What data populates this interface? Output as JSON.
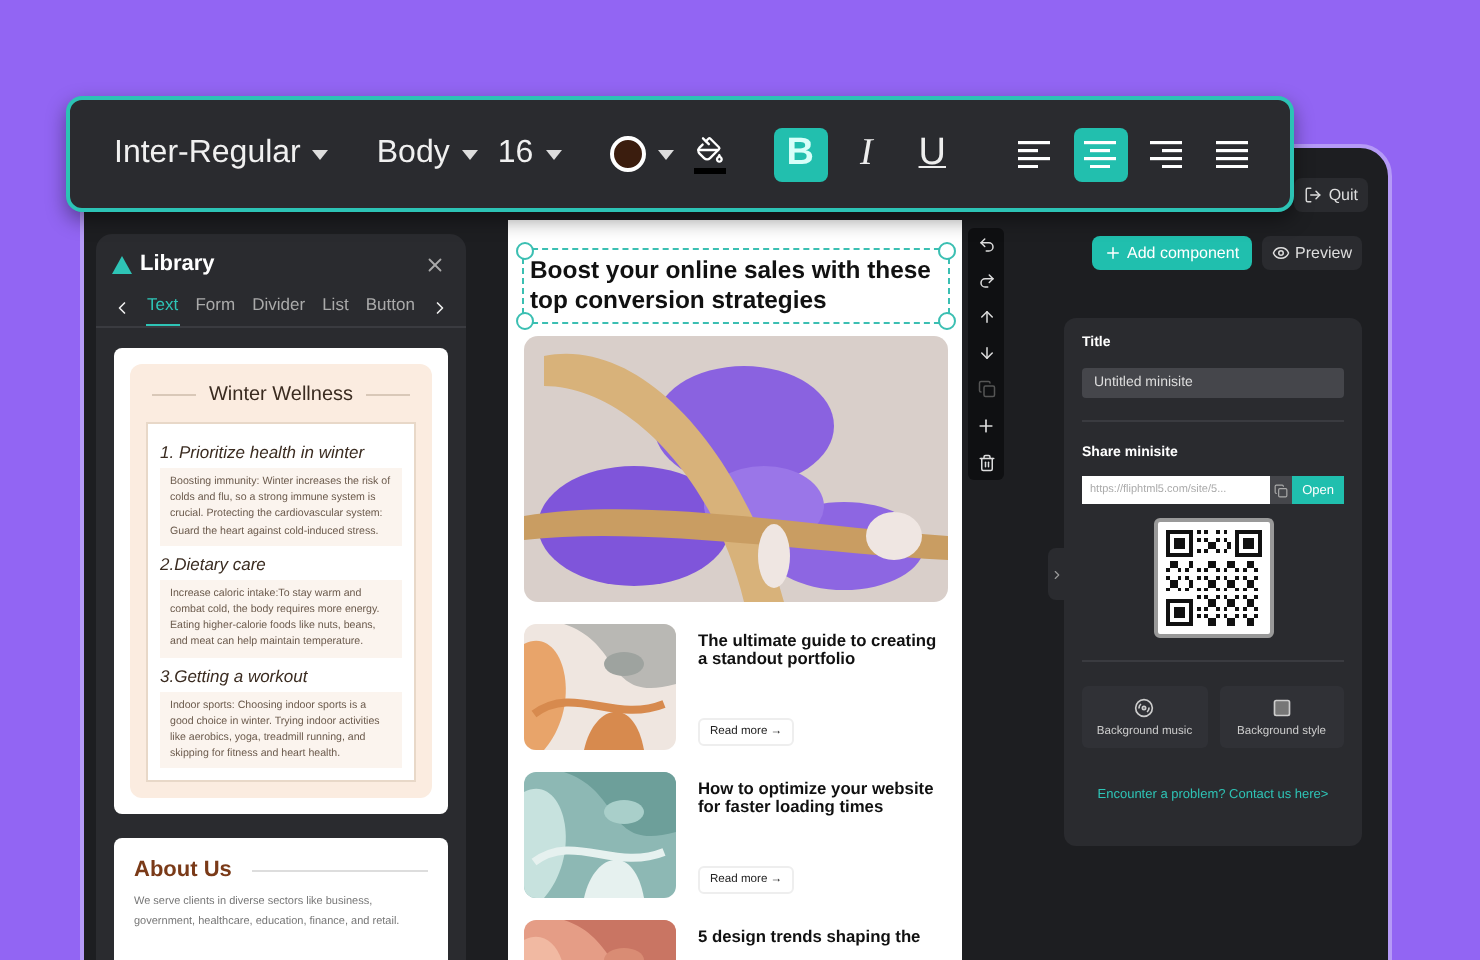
{
  "toolbar": {
    "font": "Inter-Regular",
    "style": "Body",
    "size": "16",
    "text_color": {
      "color": "#3b1d0e"
    },
    "fill_color": {
      "color": "#000000"
    },
    "format_buttons": [
      {
        "kind": "bold",
        "label": "B",
        "selected": true
      },
      {
        "kind": "italic",
        "label": "I",
        "selected": false
      },
      {
        "kind": "underline",
        "label": "U",
        "selected": false
      }
    ],
    "align_buttons": [
      {
        "kind": "left",
        "selected": false
      },
      {
        "kind": "center",
        "selected": true
      },
      {
        "kind": "right",
        "selected": false
      },
      {
        "kind": "justify",
        "selected": false
      }
    ]
  },
  "header": {
    "quit_button": "Quit",
    "add_button": "Add component",
    "preview_button": "Preview"
  },
  "library": {
    "title": "Library",
    "tabs": [
      {
        "label": "Text",
        "selected": true
      },
      {
        "label": "Form",
        "selected": false
      },
      {
        "label": "Divider",
        "selected": false
      },
      {
        "label": "List",
        "selected": false
      },
      {
        "label": "Button",
        "selected": false
      }
    ],
    "wellness_card": {
      "title": "Winter Wellness",
      "sections": [
        {
          "heading": "1. Prioritize health in winter",
          "body": "Boosting immunity: Winter increases the risk of colds and flu, so a strong immune system is crucial. Protecting the cardiovascular system: Guard the heart against cold-induced stress."
        },
        {
          "heading": "2.Dietary care",
          "body": "Increase caloric intake:To stay warm and combat cold, the body requires more energy. Eating higher-calorie foods like nuts, beans, and meat can help maintain temperature."
        },
        {
          "heading": "3.Getting a workout",
          "body": "Indoor sports:  Choosing indoor sports is a good choice in winter. Trying indoor activities like aerobics, yoga, treadmill running, and skipping for fitness and heart health."
        }
      ]
    },
    "about_card": {
      "title": "About Us",
      "body": "We serve clients in diverse sectors like business, government, healthcare, education, finance, and retail."
    }
  },
  "canvas": {
    "headline": "Boost your online sales with these top conversion strategies",
    "articles": [
      {
        "title": "The ultimate guide to creating a standout portfolio",
        "button": "Read more →"
      },
      {
        "title": "How to optimize your website for faster loading times",
        "button": "Read more →"
      },
      {
        "title": "5 design trends shaping the"
      }
    ]
  },
  "settings": {
    "title_label": "Title",
    "title_value": "Untitled minisite",
    "share_label": "Share minisite",
    "url": "https://fliphtml5.com/site/5...",
    "open_button": "Open",
    "options": [
      {
        "kind": "music",
        "label": "Background music"
      },
      {
        "kind": "style",
        "label": "Background style"
      }
    ],
    "help_link": "Encounter a problem? Contact us here>"
  }
}
